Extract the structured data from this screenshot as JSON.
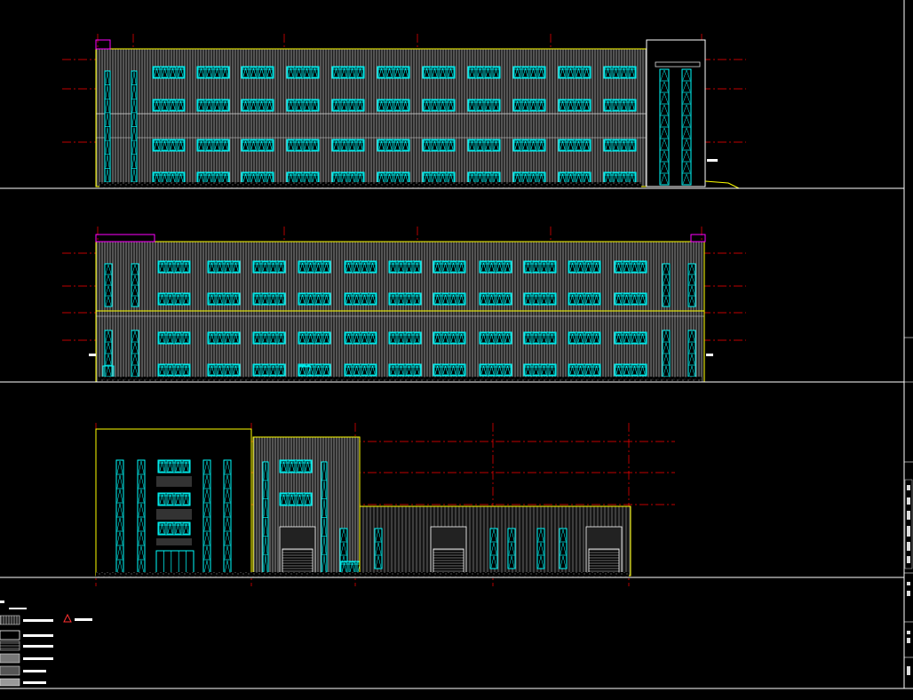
{
  "colors": {
    "background": "#000000",
    "wall_outline": "#ffff00",
    "wall_fill": "#2a2a2a",
    "cladding": "#9a9a9a",
    "window": "#00ffff",
    "grid_axis": "#ff0000",
    "parapet": "#ff00ff",
    "ground": "#ffffff",
    "legend_warning": "#ff3030"
  },
  "drawing": {
    "views": [
      {
        "name": "elevation-1"
      },
      {
        "name": "elevation-2"
      },
      {
        "name": "elevation-3"
      }
    ]
  },
  "legend": {
    "notes": [
      "",
      ""
    ],
    "items": [
      {
        "swatch": "vertical-stripes",
        "label": "",
        "warning_icon": "triangle-warning-icon"
      },
      {
        "swatch": "white-panel",
        "label": ""
      },
      {
        "swatch": "horizontal-lines",
        "label": ""
      },
      {
        "swatch": "gray-panel",
        "label": ""
      },
      {
        "swatch": "dark-gray-panel",
        "label": ""
      },
      {
        "swatch": "light-gray-panel",
        "label": ""
      }
    ]
  },
  "title_block": {
    "label": ""
  }
}
